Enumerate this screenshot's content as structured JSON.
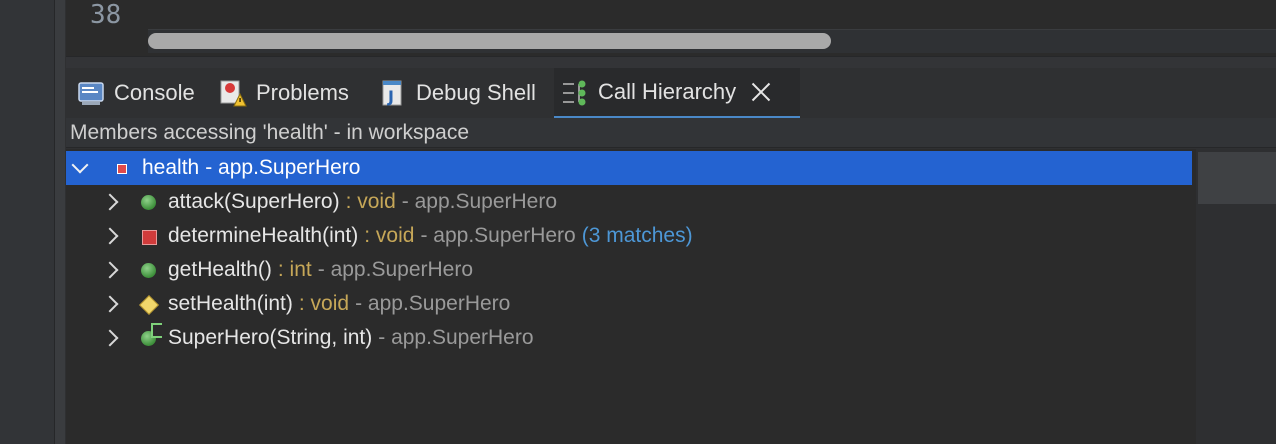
{
  "editor": {
    "line_number": "38"
  },
  "tabs": [
    {
      "label": "Console",
      "icon": "console-icon"
    },
    {
      "label": "Problems",
      "icon": "problems-icon"
    },
    {
      "label": "Debug Shell",
      "icon": "debug-shell-icon"
    },
    {
      "label": "Call Hierarchy",
      "icon": "call-hierarchy-icon",
      "active": true
    }
  ],
  "status": "Members accessing 'health' - in workspace",
  "tree": {
    "root": {
      "name": "health",
      "owner": "- app.SuperHero",
      "icon": "field-icon"
    },
    "children": [
      {
        "name": "attack(SuperHero)",
        "type": ": void",
        "owner": "- app.SuperHero",
        "matches": "",
        "icon": "public-method-icon"
      },
      {
        "name": "determineHealth(int)",
        "type": ": void",
        "owner": "- app.SuperHero",
        "matches": "(3 matches)",
        "icon": "private-method-icon"
      },
      {
        "name": "getHealth()",
        "type": ": int",
        "owner": "- app.SuperHero",
        "matches": "",
        "icon": "public-method-icon"
      },
      {
        "name": "setHealth(int)",
        "type": ": void",
        "owner": "- app.SuperHero",
        "matches": "",
        "icon": "protected-method-icon"
      },
      {
        "name": "SuperHero(String, int)",
        "type": "",
        "owner": "- app.SuperHero",
        "matches": "",
        "icon": "constructor-icon"
      }
    ]
  },
  "colors": {
    "selection": "#2463d1",
    "type": "#c6a758",
    "matches": "#4d97d6",
    "accent": "#4a88c7"
  }
}
